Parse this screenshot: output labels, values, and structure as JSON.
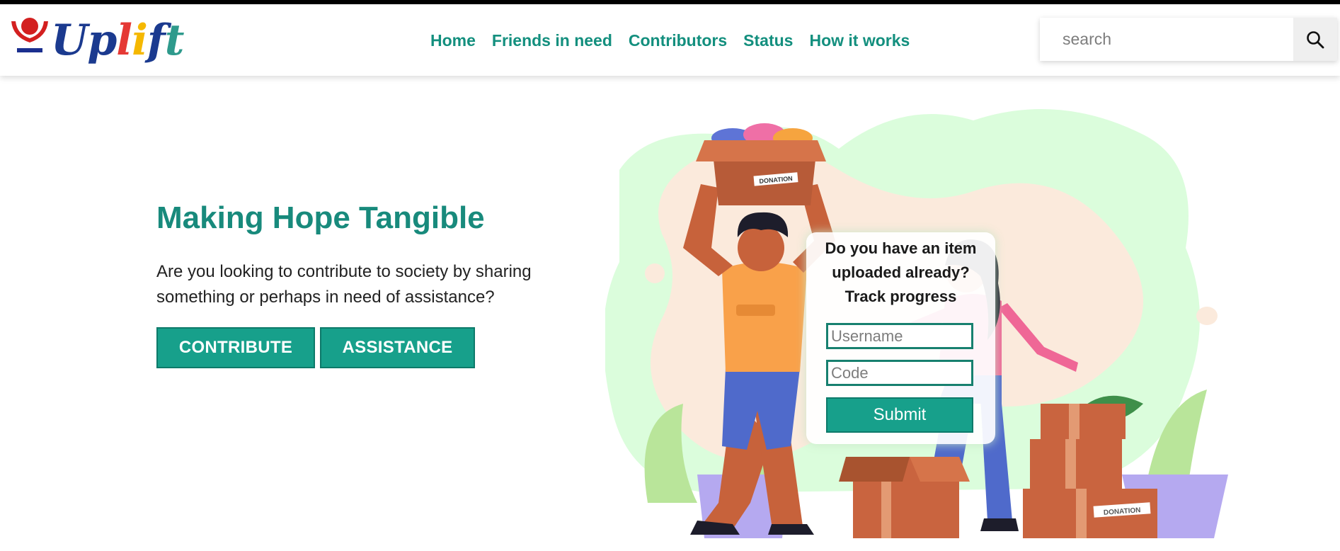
{
  "header": {
    "logo_text": "Uplift",
    "logo_letter_colors": [
      "#1b3a8f",
      "#1b3a8f",
      "#e53935",
      "#f5b800",
      "#1b3a8f",
      "#2e9a8c"
    ],
    "nav": [
      "Home",
      "Friends in need",
      "Contributors",
      "Status",
      "How it works"
    ],
    "search": {
      "placeholder": "search",
      "icon": "search-icon"
    }
  },
  "hero": {
    "title": "Making Hope Tangible",
    "description": "Are you looking to contribute to society by sharing something or perhaps in need of assistance?",
    "contribute_label": "CONTRIBUTE",
    "assistance_label": "ASSISTANCE"
  },
  "tracker": {
    "title_lines": [
      "Do you have an item",
      "uploaded already?",
      "Track progress"
    ],
    "username_placeholder": "Username",
    "code_placeholder": "Code",
    "submit_label": "Submit"
  },
  "illustration": {
    "box_label": "DONATION"
  },
  "colors": {
    "accent": "#17a08b",
    "accent_text": "#188a7c",
    "nav_text": "#138f7e"
  }
}
